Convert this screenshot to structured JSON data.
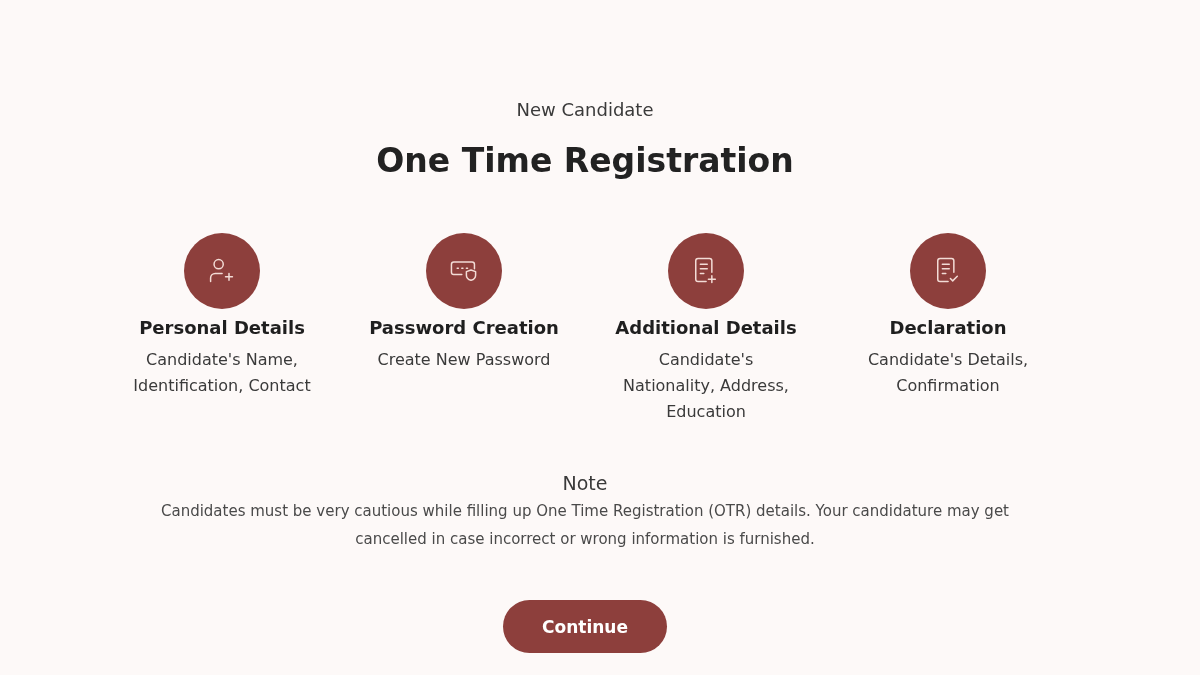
{
  "header": {
    "subtitle": "New Candidate",
    "title": "One Time Registration"
  },
  "steps": [
    {
      "kind": "user",
      "title": "Personal Details",
      "description": "Candidate's Name, Identification, Contact"
    },
    {
      "kind": "password",
      "title": "Password Creation",
      "description": "Create New Password"
    },
    {
      "kind": "form",
      "title": "Additional Details",
      "description": "Candidate's Nationality, Address, Education"
    },
    {
      "kind": "declaration",
      "title": "Declaration",
      "description": "Candidate's Details, Confirmation"
    }
  ],
  "note": {
    "heading": "Note",
    "text": "Candidates must be very cautious while filling up One Time Registration (OTR) details. Your candidature may get cancelled in case incorrect or wrong information is furnished."
  },
  "continue_button": {
    "label": "Continue"
  }
}
